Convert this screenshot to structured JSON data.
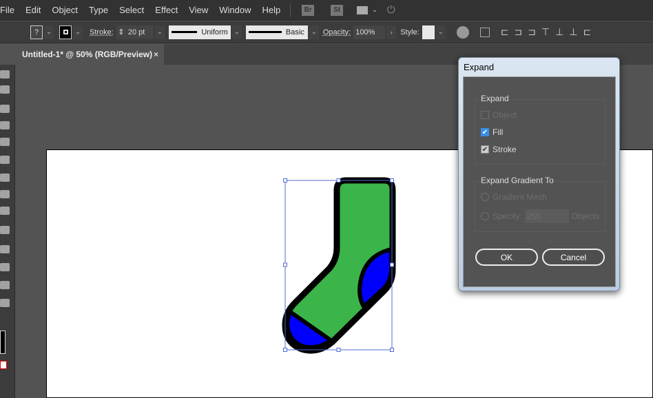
{
  "menubar": {
    "items": [
      "File",
      "Edit",
      "Object",
      "Type",
      "Select",
      "Effect",
      "View",
      "Window",
      "Help"
    ],
    "bridge": "Br",
    "stock": "St"
  },
  "control": {
    "stroke_label": "Stroke:",
    "stroke_value": "20 pt",
    "profile": "Uniform",
    "brush": "Basic",
    "opacity_label": "Opacity:",
    "opacity_value": "100%",
    "style_label": "Style:",
    "fill_unknown": "?"
  },
  "document": {
    "tab_title": "Untitled-1* @ 50% (RGB/Preview)",
    "close": "×"
  },
  "artwork": {
    "colors": {
      "sock": "#3bb54a",
      "heel_toe": "#0000ff",
      "stroke": "#000000",
      "selection": "#4f6bd8"
    }
  },
  "dialog": {
    "title": "Expand",
    "expand_group": "Expand",
    "options": [
      {
        "label": "Object",
        "checked": false,
        "enabled": false
      },
      {
        "label": "Fill",
        "checked": true,
        "enabled": true
      },
      {
        "label": "Stroke",
        "checked": true,
        "enabled": true
      }
    ],
    "gradient_group": "Expand Gradient To",
    "gradient_mesh": "Gradient Mesh",
    "specify": "Specify:",
    "specify_value": "255",
    "objects": "Objects",
    "ok": "OK",
    "cancel": "Cancel"
  }
}
